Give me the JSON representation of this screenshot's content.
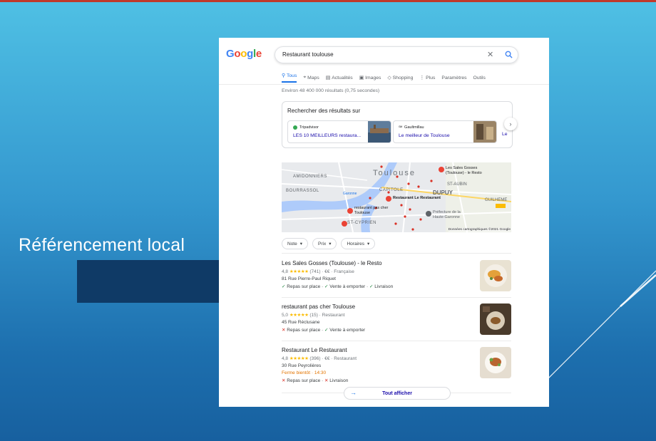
{
  "slide": {
    "title": "Référencement local"
  },
  "google": {
    "logo": [
      "G",
      "o",
      "o",
      "g",
      "l",
      "e"
    ],
    "logo_colors": [
      "#4285f4",
      "#ea4335",
      "#fbbc05",
      "#4285f4",
      "#34a853",
      "#ea4335"
    ],
    "query": "Restaurant toulouse",
    "tabs": [
      {
        "label": "Tous",
        "icon": "search-icon"
      },
      {
        "label": "Maps",
        "icon": "map-pin-icon"
      },
      {
        "label": "Actualités",
        "icon": "newspaper-icon"
      },
      {
        "label": "Images",
        "icon": "image-icon"
      },
      {
        "label": "Shopping",
        "icon": "tag-icon"
      },
      {
        "label": "Plus",
        "icon": "more-vert-icon"
      },
      {
        "label": "Paramètres"
      },
      {
        "label": "Outils"
      }
    ],
    "stats": "Environ 48 400 000 résultats (0,75 secondes)",
    "sources": {
      "title": "Rechercher des résultats sur",
      "items": [
        {
          "name": "Tripadvisor",
          "link": "LES 10 MEILLEURS restaura..."
        },
        {
          "name": "Gaultmillau",
          "link": "Le meilleur de Toulouse"
        }
      ],
      "partial": "Le"
    },
    "map": {
      "districts": [
        "AMIDONNIERS",
        "BOURRASSOL",
        "Toulouse",
        "CAPITOLE",
        "DUPUY",
        "ST-AUBIN",
        "ST-CYPRIEN",
        "GUILHEME"
      ],
      "river": "Garonne",
      "pins": [
        "Les Sales Gosses (Toulouse) - le Resto",
        "Restaurant Le Restaurant",
        "restaurant pas cher Toulouse",
        "Préfecture de la Haute-Garonne"
      ],
      "credit": "Données cartographiques ©2021 Google"
    },
    "filters": [
      "Note",
      "Prix",
      "Horaires"
    ],
    "results": [
      {
        "name": "Les Sales Gosses (Toulouse) - le Resto",
        "rating": "4,8",
        "stars": "★★★★★",
        "reviews": "(741) · €€ · Française",
        "address": "81 Rue Pierre-Paul Riquet",
        "services": [
          {
            "ok": true,
            "t": "Repas sur place"
          },
          {
            "ok": true,
            "t": "Vente à emporter"
          },
          {
            "ok": true,
            "t": "Livraison"
          }
        ]
      },
      {
        "name": "restaurant pas cher Toulouse",
        "rating": "5,0",
        "stars": "★★★★★",
        "reviews": "(15) · Restaurant",
        "address": "45 Rue Réclusane",
        "services": [
          {
            "ok": false,
            "t": "Repas sur place"
          },
          {
            "ok": true,
            "t": "Vente à emporter"
          }
        ]
      },
      {
        "name": "Restaurant Le Restaurant",
        "rating": "4,8",
        "stars": "★★★★★",
        "reviews": "(396) · €€ · Restaurant",
        "address": "30 Rue Peyrolières",
        "closing": "Ferme bientôt · 14:30",
        "services": [
          {
            "ok": false,
            "t": "Repas sur place"
          },
          {
            "ok": false,
            "t": "Livraison"
          }
        ]
      }
    ],
    "more_label": "Tout afficher"
  }
}
